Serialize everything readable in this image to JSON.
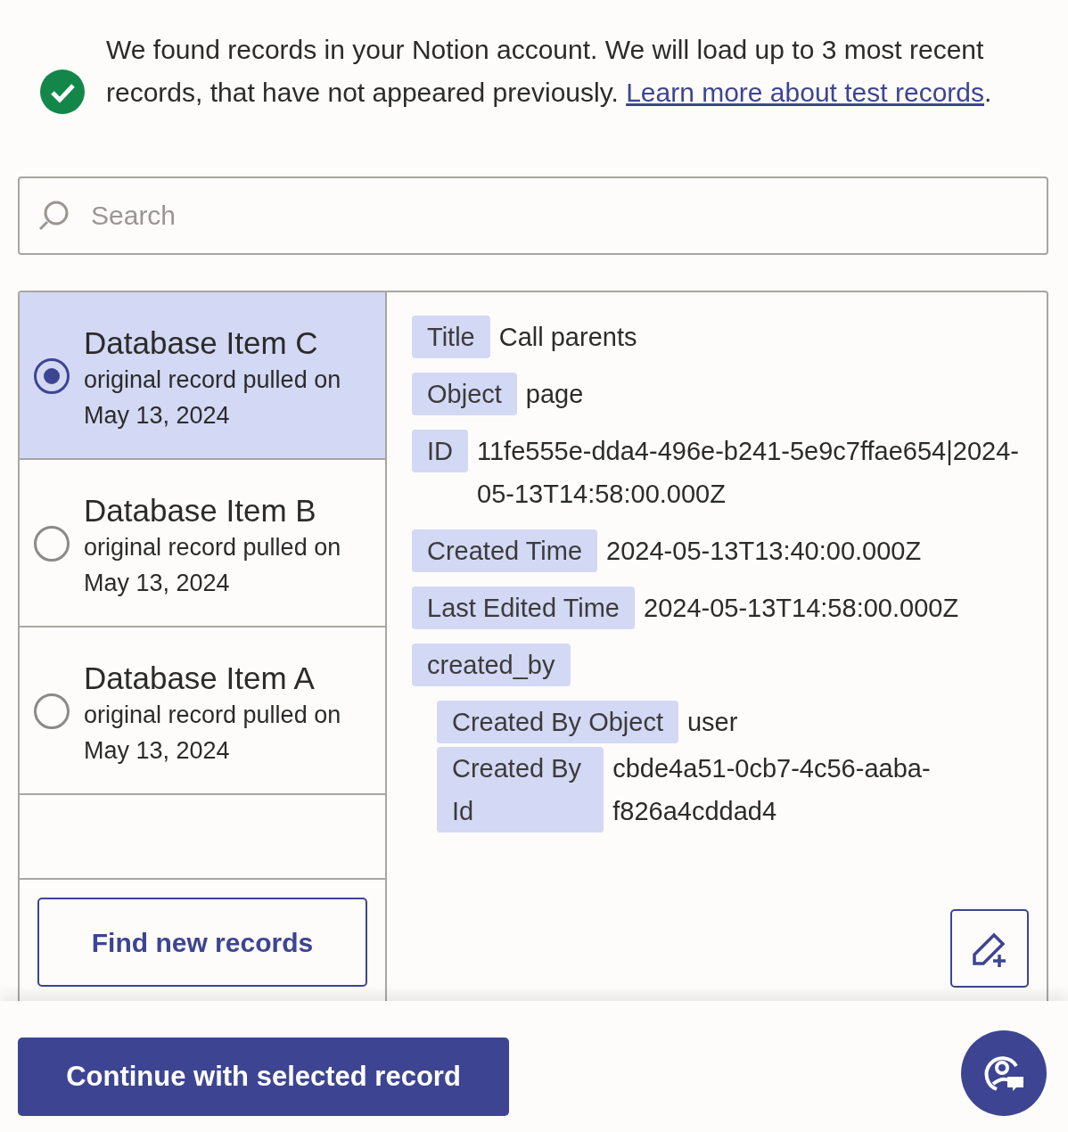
{
  "notice": {
    "text": "We found records in your Notion account. We will load up to 3 most recent records, that have not appeared previously.",
    "link": "Learn more about test records",
    "end": "."
  },
  "search": {
    "placeholder": "Search"
  },
  "records": [
    {
      "title": "Database Item C",
      "subtitle": "original record pulled on May 13, 2024",
      "selected": true
    },
    {
      "title": "Database Item B",
      "subtitle": "original record pulled on May 13, 2024",
      "selected": false
    },
    {
      "title": "Database Item A",
      "subtitle": "original record pulled on May 13, 2024",
      "selected": false
    }
  ],
  "find_button": "Find new records",
  "fields": [
    {
      "label": "Title",
      "value": "Call parents"
    },
    {
      "label": "Object",
      "value": "page"
    },
    {
      "label": "ID",
      "value": "11fe555e-dda4-496e-b241-5e9c7ffae654|2024-05-13T14:58:00.000Z"
    },
    {
      "label": "Created Time",
      "value": "2024-05-13T13:40:00.000Z"
    },
    {
      "label": "Last Edited Time",
      "value": "2024-05-13T14:58:00.000Z"
    },
    {
      "label": "created_by",
      "children": [
        {
          "label": "Created By Object",
          "value": "user"
        },
        {
          "label": "Created By Id",
          "value": "cbde4a51-0cb7-4c56-aaba-f826a4cddad4"
        }
      ]
    }
  ],
  "continue_button": "Continue with selected record"
}
